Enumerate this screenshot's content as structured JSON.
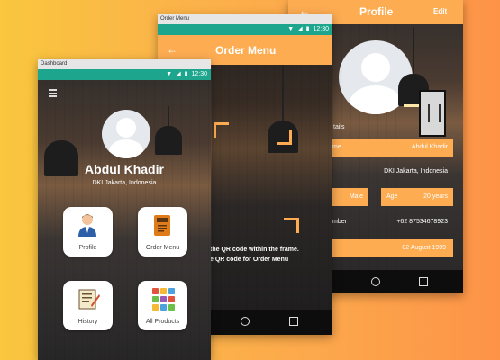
{
  "dashboard": {
    "window_title": "Dashboard",
    "time": "12:30",
    "user_name": "Abdul Khadir",
    "user_location": "DKI Jakarta, Indonesia",
    "menu": [
      {
        "label": "Profile",
        "icon": "person-icon"
      },
      {
        "label": "Order Menu",
        "icon": "menu-book-icon"
      },
      {
        "label": "History",
        "icon": "receipt-icon"
      },
      {
        "label": "All Products",
        "icon": "grid-icon"
      }
    ]
  },
  "order_menu": {
    "window_title": "Order Menu",
    "time": "12:30",
    "title": "Order Menu",
    "instruction_1": "the QR code within the frame.",
    "instruction_2": "e QR code for Order Menu"
  },
  "profile": {
    "title": "Profile",
    "edit_label": "Edit",
    "section_label": "tails",
    "name_label": "me",
    "name_value": "Abdul Khadir",
    "location_value": "DKI Jakarta, Indonesia",
    "gender_value": "Male",
    "age_label": "Age",
    "age_value": "20 years",
    "phone_label": "mber",
    "phone_value": "+62 87534678923",
    "birthdate_value": "02 August 1999"
  },
  "colors": {
    "accent": "#fdac52",
    "status": "#1ea58d"
  }
}
